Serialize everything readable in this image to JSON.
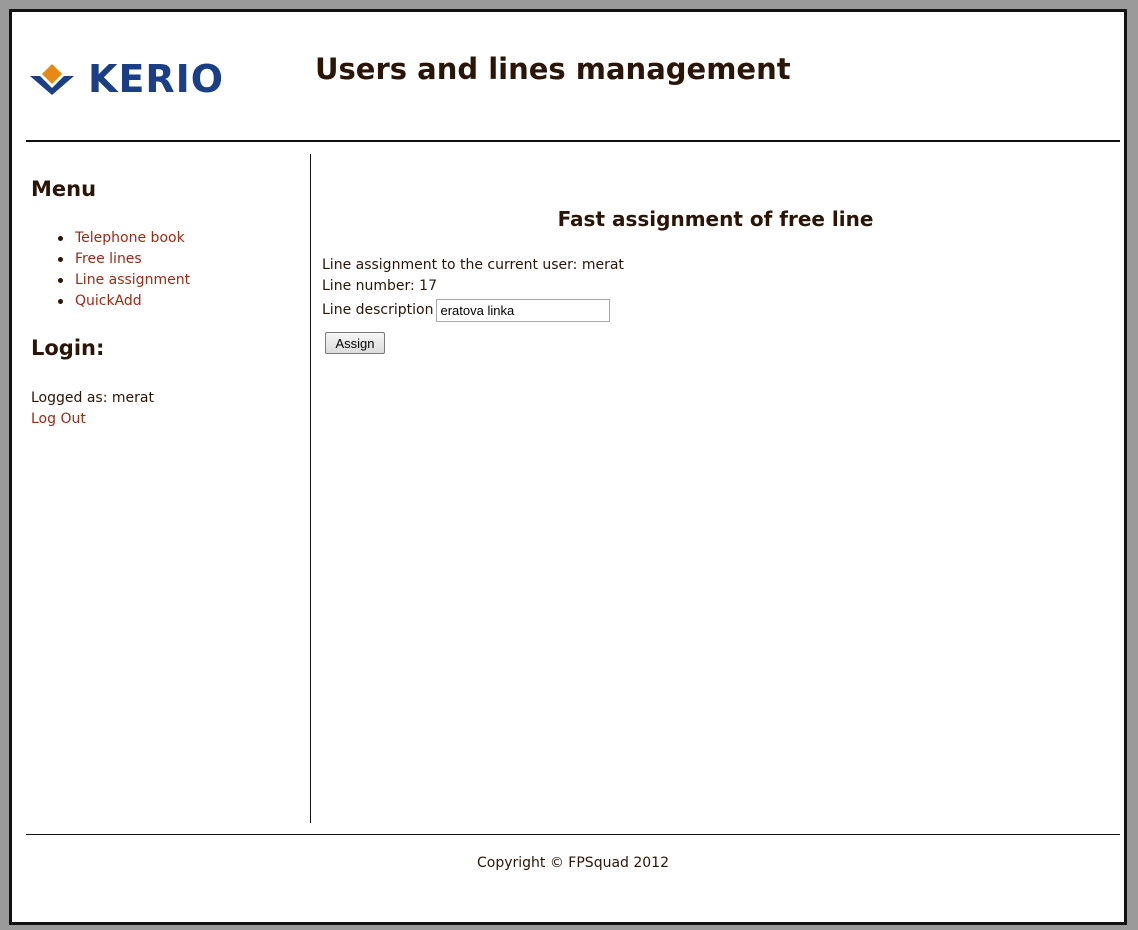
{
  "header": {
    "logo_text": "KERIO",
    "title": "Users and lines management",
    "colors": {
      "logo_blue": "#1b3f86",
      "logo_orange": "#e58a12",
      "heading": "#2a1506",
      "link": "#9b2a14"
    }
  },
  "sidebar": {
    "menu_heading": "Menu",
    "items": [
      {
        "label": "Telephone book"
      },
      {
        "label": "Free lines"
      },
      {
        "label": "Line assignment"
      },
      {
        "label": "QuickAdd"
      }
    ],
    "login_heading": "Login:",
    "logged_as": "Logged as: merat",
    "logout_label": "Log Out"
  },
  "main": {
    "heading": "Fast assignment of free line",
    "assignment_text": "Line assignment to the current user: merat",
    "line_number_text": "Line number: 17",
    "description_label": "Line description",
    "description_value": "eratova linka",
    "assign_button": "Assign"
  },
  "footer": {
    "copyright": "Copyright © FPSquad 2012"
  }
}
